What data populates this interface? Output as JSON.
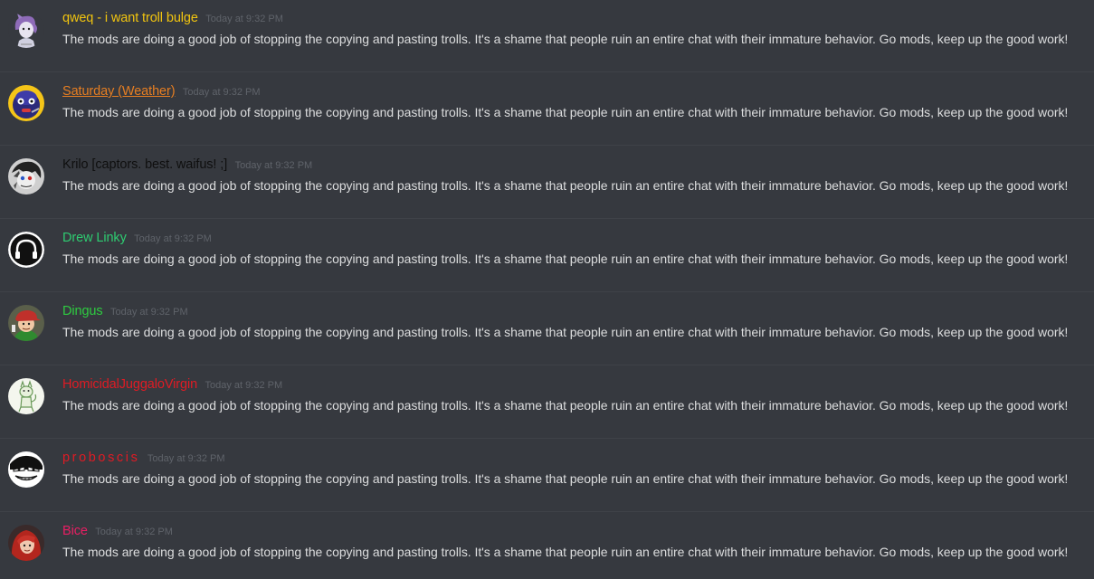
{
  "messages": [
    {
      "username": "qweq - i want troll bulge",
      "username_color": "#f1c40f",
      "timestamp": "Today at 9:32 PM",
      "text": "The mods are doing a good job of stopping the copying and pasting trolls. It's a shame that people ruin an entire chat with their immature behavior. Go mods, keep up the good work!",
      "avatar_icon": "purple-hair-character-avatar"
    },
    {
      "username": "Saturday (Weather)",
      "username_color": "#e67e22",
      "timestamp": "Today at 9:32 PM",
      "text": "The mods are doing a good job of stopping the copying and pasting trolls. It's a shame that people ruin an entire chat with their immature behavior. Go mods, keep up the good work!",
      "avatar_icon": "purple-helmet-character-avatar"
    },
    {
      "username": "Krilo [captors. best. waifus! ;]",
      "username_color": "#0f0f0f",
      "timestamp": "Today at 9:32 PM",
      "text": "The mods are doing a good job of stopping the copying and pasting trolls. It's a shame that people ruin an entire chat with their immature behavior. Go mods, keep up the good work!",
      "avatar_icon": "sketch-character-avatar"
    },
    {
      "username": "Drew Linky",
      "username_color": "#2ecc71",
      "timestamp": "Today at 9:32 PM",
      "text": "The mods are doing a good job of stopping the copying and pasting trolls. It's a shame that people ruin an entire chat with their immature behavior. Go mods, keep up the good work!",
      "avatar_icon": "headphones-icon-avatar"
    },
    {
      "username": "Dingus",
      "username_color": "#2ecc40",
      "timestamp": "Today at 9:32 PM",
      "text": "The mods are doing a good job of stopping the copying and pasting trolls. It's a shame that people ruin an entire chat with their immature behavior. Go mods, keep up the good work!",
      "avatar_icon": "red-cap-character-avatar"
    },
    {
      "username": "HomicidalJuggaloVirgin",
      "username_color": "#e01b24",
      "timestamp": "Today at 9:32 PM",
      "text": "The mods are doing a good job of stopping the copying and pasting trolls. It's a shame that people ruin an entire chat with their immature behavior. Go mods, keep up the good work!",
      "avatar_icon": "green-doodle-avatar"
    },
    {
      "username": "proboscis",
      "username_color": "#e01b24",
      "timestamp": "Today at 9:32 PM",
      "text": "The mods are doing a good job of stopping the copying and pasting trolls. It's a shame that people ruin an entire chat with their immature behavior. Go mods, keep up the good work!",
      "avatar_icon": "troll-face-avatar"
    },
    {
      "username": "Bice",
      "username_color": "#e91e63",
      "timestamp": "Today at 9:32 PM",
      "text": "The mods are doing a good job of stopping the copying and pasting trolls. It's a shame that people ruin an entire chat with their immature behavior. Go mods, keep up the good work!",
      "avatar_icon": "red-hair-character-avatar"
    }
  ]
}
